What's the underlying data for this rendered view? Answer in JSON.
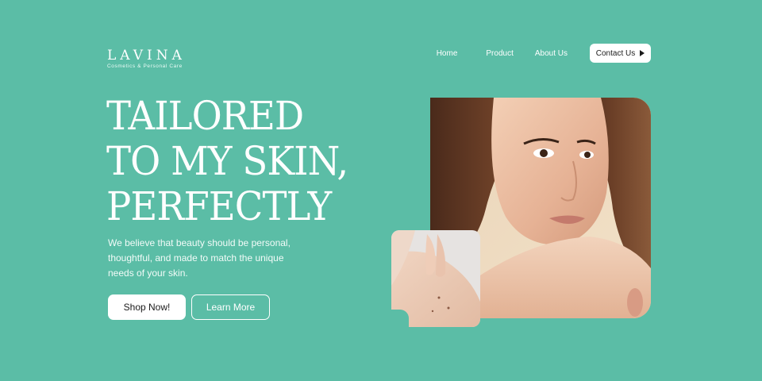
{
  "brand": {
    "name": "LAVINA",
    "tagline": "Cosmetics & Personal Care"
  },
  "nav": {
    "items": [
      "Home",
      "Product",
      "About Us"
    ],
    "contact": "Contact Us"
  },
  "hero": {
    "headline": [
      "TAILORED",
      "TO MY SKIN,",
      "PERFECTLY"
    ],
    "description": "We believe that beauty should be personal, thoughtful, and made to match the unique needs of your skin.",
    "primary_button": "Shop Now!",
    "secondary_button": "Learn More"
  },
  "colors": {
    "background": "#5bbda6",
    "text": "#ffffff",
    "button_text": "#1b1b1b"
  }
}
